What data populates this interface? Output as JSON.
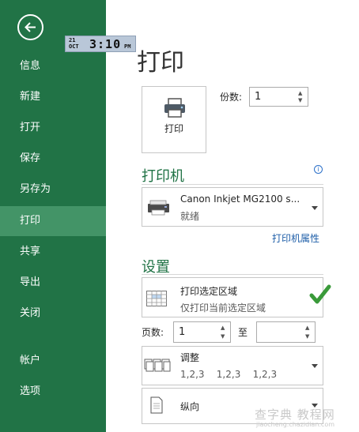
{
  "sidebar": {
    "items": [
      {
        "label": "信息"
      },
      {
        "label": "新建"
      },
      {
        "label": "打开"
      },
      {
        "label": "保存"
      },
      {
        "label": "另存为"
      },
      {
        "label": "打印"
      },
      {
        "label": "共享"
      },
      {
        "label": "导出"
      },
      {
        "label": "关闭"
      },
      {
        "label": "帐户"
      },
      {
        "label": "选项"
      }
    ],
    "active_index": 5,
    "bg_color": "#217346"
  },
  "clock": {
    "date_day": "21",
    "date_month": "OCT",
    "time": "3:10",
    "ampm": "PM"
  },
  "page": {
    "title": "打印"
  },
  "print_button": {
    "label": "打印"
  },
  "copies": {
    "label": "份数:",
    "value": "1"
  },
  "printer": {
    "section_title": "打印机",
    "name": "Canon Inkjet MG2100 s...",
    "status": "就绪",
    "properties_link": "打印机属性"
  },
  "settings": {
    "section_title": "设置",
    "print_range": {
      "main": "打印选定区域",
      "sub": "仅打印当前选定区域"
    },
    "pages_label": "页数:",
    "pages_from": "1",
    "to_label": "至",
    "pages_to": "",
    "collate": {
      "main": "调整",
      "sub": "1,2,3    1,2,3    1,2,3"
    },
    "orientation": {
      "main": "纵向"
    }
  },
  "watermark": {
    "text": "查字典 教程网",
    "sub": "jiaocheng.chazidian.com"
  }
}
